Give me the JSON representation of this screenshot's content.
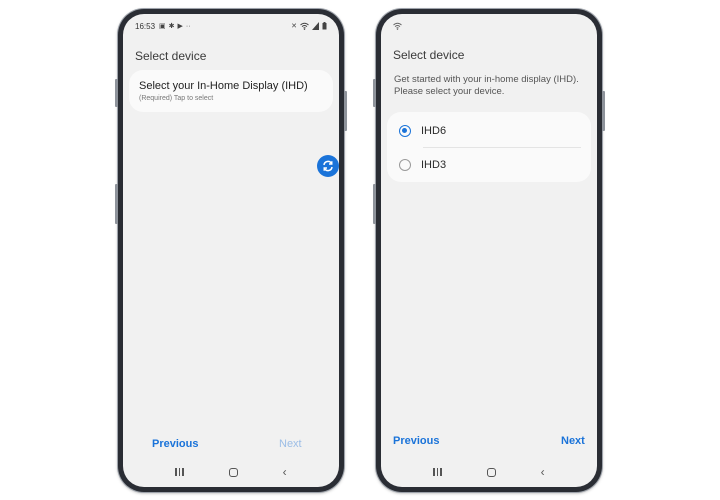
{
  "left_phone": {
    "status_bar": {
      "time": "16:53",
      "left_icons": [
        "gallery-icon",
        "settings-icon",
        "play-icon",
        "more-icon"
      ],
      "right_icons": [
        "mute-icon",
        "wifi-icon",
        "signal-icon",
        "battery-icon"
      ]
    },
    "title": "Select device",
    "card": {
      "title": "Select your In-Home Display (IHD)",
      "subtitle": "(Required) Tap to select"
    },
    "fab_icon": "sync-icon",
    "previous_label": "Previous",
    "next_label": "Next"
  },
  "right_phone": {
    "title": "Select device",
    "subtitle": "Get started with your in-home display (IHD). Please select your device.",
    "options": [
      {
        "label": "IHD6",
        "selected": true
      },
      {
        "label": "IHD3",
        "selected": false
      }
    ],
    "previous_label": "Previous",
    "next_label": "Next"
  },
  "colors": {
    "accent": "#1a73d9",
    "disabled": "#9bbde6",
    "screen_bg": "#f1f1f1",
    "card_bg": "#fafafa",
    "frame": "#2a2d34"
  }
}
